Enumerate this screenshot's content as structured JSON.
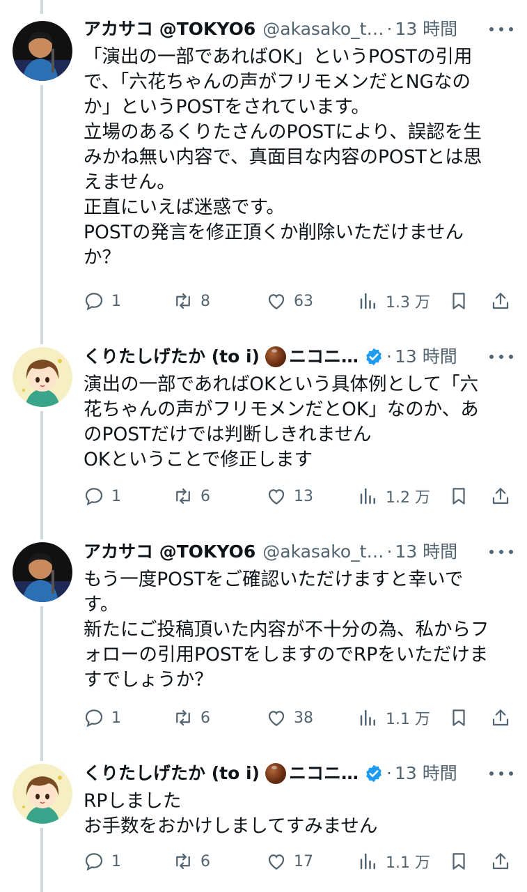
{
  "tweets": [
    {
      "name": "アカサコ @TOKYO6",
      "handle": "@akasako_t…",
      "time": "13 時間",
      "lines": [
        "「演出の一部であればOK」というPOSTの引用",
        "で、「六花ちゃんの声がフリモメンだとNGなの",
        "か」というPOSTをされています。",
        "立場のあるくりたさんのPOSTにより、誤認を生",
        "みかね無い内容で、真面目な内容のPOSTとは思",
        "えません。",
        "正直にいえば迷惑です。",
        "POSTの発言を修正頂くか削除いただけません",
        "か？"
      ],
      "replies": "1",
      "reposts": "8",
      "likes": "63",
      "views": "1.3 万"
    },
    {
      "name": "くりたしげたか (to i)",
      "name_suffix": "ニコニ…",
      "time": "13 時間",
      "lines": [
        "演出の一部であればOKという具体例として「六",
        "花ちゃんの声がフリモメンだとOK」なのか、あ",
        "のPOSTだけでは判断しきれません",
        "OKということで修正します"
      ],
      "replies": "1",
      "reposts": "6",
      "likes": "13",
      "views": "1.2 万"
    },
    {
      "name": "アカサコ @TOKYO6",
      "handle": "@akasako_t…",
      "time": "13 時間",
      "lines": [
        "もう一度POSTをご確認いただけますと幸いで",
        "す。",
        "新たにご投稿頂いた内容が不十分の為、私からフ",
        "ォローの引用POSTをしますのでRPをいただけま",
        "すでしょうか？"
      ],
      "replies": "1",
      "reposts": "6",
      "likes": "38",
      "views": "1.1 万"
    },
    {
      "name": "くりたしげたか (to i)",
      "name_suffix": "ニコニ…",
      "time": "13 時間",
      "lines": [
        "RPしました",
        "お手数をおかけしましてすみません"
      ],
      "replies": "1",
      "reposts": "6",
      "likes": "17",
      "views": "1.1 万"
    }
  ],
  "colors": {
    "text": "#0f1419",
    "secondary": "#536471",
    "thread_line": "#cfd9de",
    "verified": "#1d9bf0"
  },
  "icons": [
    "reply-icon",
    "repost-icon",
    "like-icon",
    "views-icon",
    "bookmark-icon",
    "share-icon",
    "more-icon",
    "verified-icon",
    "chestnut-emoji-icon"
  ]
}
